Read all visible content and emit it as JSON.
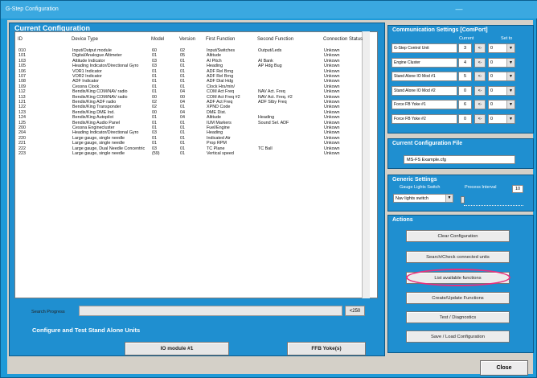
{
  "window": {
    "title": "G-Step Configuration"
  },
  "current_config": {
    "title": "Current Configuration",
    "columns": [
      "ID",
      "Device Type",
      "Model",
      "Version",
      "First Function",
      "Second Function",
      "Connection Status"
    ],
    "rows": [
      [
        "010",
        "Input/Output module",
        "60",
        "02",
        "Input/Switches",
        "Output/Leds",
        "Unkown"
      ],
      [
        "101",
        "Digital/Analogue Altimeter",
        "01",
        "05",
        "Altitude",
        "",
        "Unkown"
      ],
      [
        "103",
        "Attitude Indicator",
        "03",
        "01",
        "AI Pitch",
        "AI Bank",
        "Unkown"
      ],
      [
        "105",
        "Heading Indicator/Directional Gyro",
        "03",
        "01",
        "Heading",
        "AP Hdg Bug",
        "Unkown"
      ],
      [
        "106",
        "VOR1 Indicator",
        "01",
        "01",
        "ADF Rel Brng",
        "",
        "Unkown"
      ],
      [
        "107",
        "VOR2 Indicator",
        "01",
        "01",
        "ADF Rel Brng",
        "",
        "Unkown"
      ],
      [
        "108",
        "ADF Indicator",
        "01",
        "01",
        "ADF Dial Hdg",
        "",
        "Unkown"
      ],
      [
        "109",
        "Cessna Clock",
        "01",
        "01",
        "Clock Hrs/min/",
        "",
        "Unkown"
      ],
      [
        "112",
        "Bendix/King COM/NAV radio",
        "01",
        "04",
        "COM Act Freq",
        "NAV Act. Freq",
        "Unkown"
      ],
      [
        "113",
        "Bendix/King COM/NAV radio",
        "00",
        "00",
        "COM Act Freq #2",
        "NAV Act. Freq. #2",
        "Unkown"
      ],
      [
        "121",
        "Bendix/King ADF radio",
        "02",
        "04",
        "ADF Act Freq",
        "ADF Stby Freq",
        "Unkown"
      ],
      [
        "122",
        "Bendix/King Transponder",
        "02",
        "01",
        "XPND Code",
        "",
        "Unkown"
      ],
      [
        "123",
        "Bendix/King DME Ind.",
        "00",
        "04",
        "DME Dist.",
        "",
        "Unkown"
      ],
      [
        "124",
        "Bendix/King Autopilot",
        "01",
        "04",
        "Altitude",
        "Heading",
        "Unkown"
      ],
      [
        "125",
        "Bendix/King Audio Panel",
        "01",
        "01",
        "IUM Markers",
        "Sound Sel. ADF",
        "Unkown"
      ],
      [
        "200",
        "Cessna Enginecluster",
        "01",
        "01",
        "Fuel/Engine",
        "",
        "Unkown"
      ],
      [
        "204",
        "Heading Indicator/Directional Gyro",
        "03",
        "01",
        "Heading",
        "",
        "Unkown"
      ],
      [
        "220",
        "Large gauge, single needle",
        "01",
        "01",
        "Indicated Air",
        "",
        "Unkown"
      ],
      [
        "221",
        "Large gauge, single needle",
        "01",
        "01",
        "Prop RPM",
        "",
        "Unkown"
      ],
      [
        "222",
        "Large gauge, Dual Needle Concentric",
        "03",
        "01",
        "TC Plane",
        "TC Ball",
        "Unkown"
      ],
      [
        "223",
        "Large gauge, single needle",
        "(59)",
        "01",
        "Vertical speed",
        "",
        "Unkown"
      ]
    ],
    "search_progress_label": "Search Progress",
    "search_progress_value": "<250"
  },
  "standalone": {
    "title": "Configure and Test Stand Alone Units",
    "btn_io": "IO module #1",
    "btn_ffb": "FFB Yoke(s)"
  },
  "comm": {
    "title": "Communication Settings [ComPort]",
    "col_current": "Current",
    "col_setto": "Set to",
    "rows": [
      {
        "label": "G-Step Control Unit",
        "current": "3",
        "btn": "<-",
        "set": "0"
      },
      {
        "label": "Engine Cluster",
        "current": "4",
        "btn": "<-",
        "set": "0"
      },
      {
        "label": "Stand Alone IO Mod #1",
        "current": "5",
        "btn": "<-",
        "set": "0"
      },
      {
        "label": "Stand Alone IO Mod #2",
        "current": "0",
        "btn": "<-",
        "set": "0"
      },
      {
        "label": "Force FB Yoke #1",
        "current": "6",
        "btn": "<-",
        "set": "0"
      },
      {
        "label": "Force FB Yoke #2",
        "current": "0",
        "btn": "<-",
        "set": "0"
      }
    ]
  },
  "config_file": {
    "title": "Current Configuration File",
    "value": "MS-FS Example.cfg"
  },
  "generic": {
    "title": "Generic Settings",
    "gauge_label": "Gauge Lights Switch",
    "interval_label": "Process Interval",
    "interval_value": "10",
    "gauge_value": "Nav lights switch"
  },
  "actions": {
    "title": "Actions",
    "buttons": [
      "Clear Configuration",
      "Search/Check connected units",
      "List available functions",
      "Create/Update Functions",
      "Test / Diagnostics",
      "Save / Load Configuration"
    ]
  },
  "close_label": "Close",
  "colors": {
    "panel_blue": "#1f8fd0",
    "highlight": "#e8307e"
  }
}
